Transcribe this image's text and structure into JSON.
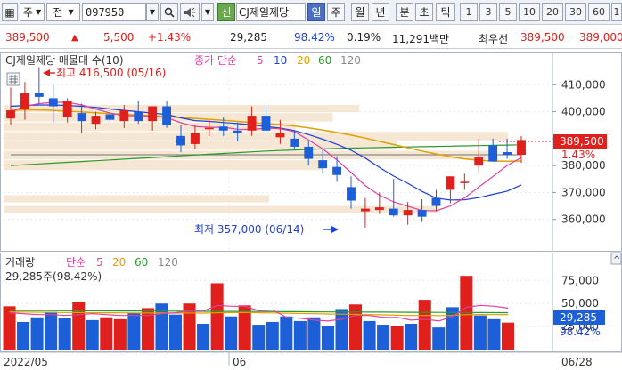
{
  "toolbar": {
    "market": "주",
    "code_type": "전",
    "code": "097950",
    "new_label": "신",
    "stock_name": "CJ제일제당",
    "periods": [
      "일",
      "주",
      "월",
      "년",
      "분",
      "초",
      "틱"
    ],
    "active_period": "일",
    "intervals": [
      "1",
      "3",
      "5",
      "10",
      "20",
      "30",
      "60",
      "1"
    ]
  },
  "quote": {
    "price": "389,500",
    "change": "5,500",
    "change_pct": "+1.43%",
    "volume": "29,285",
    "volume_ratio": "98.42%",
    "turnover_rate": "0.19%",
    "amount": "11,291백만",
    "best_ask_label": "최우선",
    "best_ask_1": "389,500",
    "best_ask_2": "389,000"
  },
  "colors": {
    "up": "#e0201c",
    "down": "#1c5fd8",
    "ma5": "#e040a0",
    "ma10": "#1c3fd8",
    "ma20": "#e0a000",
    "ma60": "#2a9a2a",
    "ma120": "#888888",
    "profile": "#f5e3cc"
  },
  "chart_data": {
    "type": "candlestick",
    "title": "CJ제일제당 매물대 수(10)",
    "ma_legend": {
      "label": "종가 단순",
      "periods": [
        "5",
        "10",
        "20",
        "60",
        "120"
      ]
    },
    "y_ticks": [
      "410,000",
      "400,000",
      "390,000",
      "380,000",
      "370,000",
      "360,000"
    ],
    "ylim": [
      350000,
      420000
    ],
    "current_price_label": "389,500",
    "current_change_label": "1.43%",
    "high_annotation": "최고 416,500 (05/16)",
    "low_annotation": "최저 357,000 (06/14)",
    "x_labels": [
      "2022/05",
      "06",
      "06/28"
    ],
    "candles": [
      {
        "o": 397500,
        "h": 409000,
        "l": 395000,
        "c": 400500
      },
      {
        "o": 401000,
        "h": 411000,
        "l": 397000,
        "c": 407000
      },
      {
        "o": 407000,
        "h": 416500,
        "l": 403000,
        "c": 405500
      },
      {
        "o": 405000,
        "h": 410000,
        "l": 396000,
        "c": 402000
      },
      {
        "o": 398000,
        "h": 405000,
        "l": 396000,
        "c": 404000
      },
      {
        "o": 399500,
        "h": 403000,
        "l": 392000,
        "c": 396500
      },
      {
        "o": 395500,
        "h": 400000,
        "l": 393500,
        "c": 398500
      },
      {
        "o": 399000,
        "h": 402000,
        "l": 396000,
        "c": 397000
      },
      {
        "o": 396500,
        "h": 402500,
        "l": 394000,
        "c": 400500
      },
      {
        "o": 400000,
        "h": 404000,
        "l": 395500,
        "c": 396500
      },
      {
        "o": 396500,
        "h": 402000,
        "l": 393000,
        "c": 402000
      },
      {
        "o": 402000,
        "h": 404000,
        "l": 394000,
        "c": 395000
      },
      {
        "o": 391000,
        "h": 395000,
        "l": 385000,
        "c": 387500
      },
      {
        "o": 388000,
        "h": 395000,
        "l": 386000,
        "c": 392000
      },
      {
        "o": 394000,
        "h": 397000,
        "l": 391000,
        "c": 394000
      },
      {
        "o": 394500,
        "h": 398000,
        "l": 391000,
        "c": 393000
      },
      {
        "o": 393000,
        "h": 396000,
        "l": 389000,
        "c": 392000
      },
      {
        "o": 393000,
        "h": 402000,
        "l": 391000,
        "c": 398500
      },
      {
        "o": 398500,
        "h": 402000,
        "l": 392000,
        "c": 393000
      },
      {
        "o": 390500,
        "h": 397000,
        "l": 388000,
        "c": 392000
      },
      {
        "o": 390000,
        "h": 393000,
        "l": 386000,
        "c": 387000
      },
      {
        "o": 387000,
        "h": 389000,
        "l": 380000,
        "c": 382500
      },
      {
        "o": 382000,
        "h": 386000,
        "l": 377000,
        "c": 379000
      },
      {
        "o": 379500,
        "h": 383500,
        "l": 374000,
        "c": 376500
      },
      {
        "o": 372000,
        "h": 376000,
        "l": 364000,
        "c": 367000
      },
      {
        "o": 363000,
        "h": 368000,
        "l": 357000,
        "c": 364000
      },
      {
        "o": 363500,
        "h": 370000,
        "l": 362000,
        "c": 364500
      },
      {
        "o": 364000,
        "h": 375000,
        "l": 361000,
        "c": 361500
      },
      {
        "o": 361500,
        "h": 366500,
        "l": 358000,
        "c": 363500
      },
      {
        "o": 363500,
        "h": 367500,
        "l": 359000,
        "c": 361000
      },
      {
        "o": 368000,
        "h": 371000,
        "l": 363000,
        "c": 365000
      },
      {
        "o": 371000,
        "h": 376000,
        "l": 366000,
        "c": 376000
      },
      {
        "o": 373500,
        "h": 377000,
        "l": 371000,
        "c": 374000
      },
      {
        "o": 380000,
        "h": 390000,
        "l": 377000,
        "c": 383000
      },
      {
        "o": 387500,
        "h": 390000,
        "l": 382000,
        "c": 381500
      },
      {
        "o": 385000,
        "h": 390000,
        "l": 382500,
        "c": 384000
      },
      {
        "o": 384000,
        "h": 391000,
        "l": 381000,
        "c": 389500
      }
    ],
    "ma": {
      "ma5": [
        400000,
        402000,
        403000,
        403500,
        403500,
        402500,
        401000,
        399500,
        398500,
        398500,
        398300,
        397800,
        395900,
        394500,
        394200,
        394200,
        393500,
        393400,
        393900,
        393700,
        392600,
        389500,
        386200,
        382100,
        377400,
        372600,
        369000,
        366500,
        364900,
        363300,
        363200,
        365000,
        368000,
        372000,
        376000,
        380000,
        383000
      ],
      "ma10": [
        402000,
        402300,
        402500,
        402500,
        402300,
        402000,
        401600,
        401000,
        400500,
        400000,
        399500,
        399000,
        397700,
        396700,
        396400,
        396000,
        395600,
        395100,
        394500,
        393900,
        393000,
        391500,
        389800,
        387900,
        385700,
        382800,
        379300,
        376100,
        373400,
        370400,
        367900,
        367200,
        367300,
        368100,
        369300,
        370500,
        372800
      ],
      "ma20": [
        400500,
        400700,
        400700,
        400500,
        400200,
        399900,
        399600,
        399300,
        399000,
        398800,
        398500,
        398200,
        397800,
        397500,
        397200,
        396800,
        396400,
        396000,
        395600,
        395200,
        394700,
        394000,
        393200,
        392300,
        391300,
        390200,
        389000,
        387800,
        386600,
        385400,
        384300,
        383300,
        382500,
        382000,
        381700,
        381600,
        381700
      ],
      "ma60": [
        380000,
        380300,
        380600,
        380900,
        381200,
        381500,
        381800,
        382100,
        382400,
        382700,
        383000,
        383300,
        383600,
        383900,
        384200,
        384500,
        384800,
        385100,
        385400,
        385600,
        385800,
        386000,
        386200,
        386400,
        386500,
        386600,
        386700,
        386800,
        386900,
        387000,
        387100,
        387200,
        387300,
        387400,
        387500,
        387600,
        387700
      ],
      "ma120": [
        384000,
        384000,
        384000,
        384000,
        384000,
        384000,
        384000,
        384000,
        384000,
        384000,
        384000,
        384000,
        384000,
        384000,
        384000,
        384000,
        384000,
        384000,
        384000,
        384000,
        384000,
        384000,
        384000,
        384000,
        384000,
        384000,
        384000,
        384000,
        384000,
        384000,
        384000,
        384000,
        384000,
        384000,
        384000,
        384000,
        384000
      ]
    },
    "volume_profile": [
      {
        "low": 362000,
        "high": 365000,
        "size": 0.82
      },
      {
        "low": 366000,
        "high": 369000,
        "size": 0.5
      },
      {
        "low": 378000,
        "high": 382000,
        "size": 0.6
      },
      {
        "low": 382000,
        "high": 385500,
        "size": 0.92
      },
      {
        "low": 385500,
        "high": 389000,
        "size": 0.74
      },
      {
        "low": 389000,
        "high": 392500,
        "size": 0.95
      },
      {
        "low": 392500,
        "high": 396000,
        "size": 0.55
      },
      {
        "low": 396000,
        "high": 399500,
        "size": 0.62
      },
      {
        "low": 399500,
        "high": 402500,
        "size": 0.67
      }
    ],
    "volume": {
      "title": "거래량",
      "ma_legend": {
        "label": "단순",
        "periods": [
          "5",
          "20",
          "60",
          "120"
        ]
      },
      "current_label": "29,285주(98.42%)",
      "y_ticks": [
        "75,000",
        "50,000",
        "25,000"
      ],
      "ylim": [
        0,
        85000
      ],
      "current_value_label": "29,285",
      "current_pct_label": "98.42%",
      "values": [
        47000,
        30000,
        35000,
        41000,
        34000,
        52000,
        32000,
        35000,
        33000,
        40000,
        45000,
        50000,
        38000,
        50000,
        28000,
        72000,
        36000,
        48000,
        27000,
        30000,
        36000,
        31000,
        35000,
        26000,
        44000,
        49000,
        31000,
        27000,
        26000,
        28000,
        54000,
        24000,
        46000,
        80000,
        37000,
        33000,
        29285
      ],
      "up_flags": [
        1,
        0,
        0,
        0,
        0,
        1,
        0,
        1,
        1,
        0,
        1,
        0,
        0,
        1,
        0,
        1,
        0,
        1,
        0,
        0,
        0,
        0,
        0,
        0,
        0,
        1,
        0,
        0,
        1,
        0,
        1,
        0,
        0,
        1,
        0,
        0,
        1
      ],
      "ma5": [
        40000,
        39000,
        38000,
        38000,
        37000,
        38000,
        39000,
        38000,
        37000,
        37000,
        37000,
        39000,
        40000,
        42000,
        42000,
        48000,
        47000,
        47000,
        42000,
        43000,
        35000,
        34000,
        32000,
        31000,
        33000,
        37000,
        37000,
        35000,
        35000,
        32000,
        33000,
        31000,
        36000,
        46000,
        48000,
        47000,
        45000
      ],
      "ma20": [
        41000,
        40800,
        40600,
        40400,
        40300,
        40200,
        40100,
        40000,
        39900,
        39800,
        39700,
        39700,
        39600,
        39700,
        39600,
        40000,
        40100,
        40200,
        40000,
        39800,
        39500,
        39200,
        38900,
        38600,
        38400,
        38200,
        38000,
        37700,
        37300,
        37000,
        37100,
        36900,
        37100,
        38000,
        38100,
        38000,
        38100
      ],
      "ma60": [
        42500,
        42400,
        42300,
        42300,
        42200,
        42100,
        42100,
        42000,
        41900,
        41900,
        41800,
        41700,
        41700,
        41600,
        41500,
        41500,
        41400,
        41300,
        41300,
        41200,
        41100,
        41100,
        41000,
        40900,
        40900,
        40800,
        40700,
        40700,
        40600,
        40500,
        40500,
        40400,
        40300,
        40300,
        40200,
        40100,
        40100
      ]
    }
  }
}
